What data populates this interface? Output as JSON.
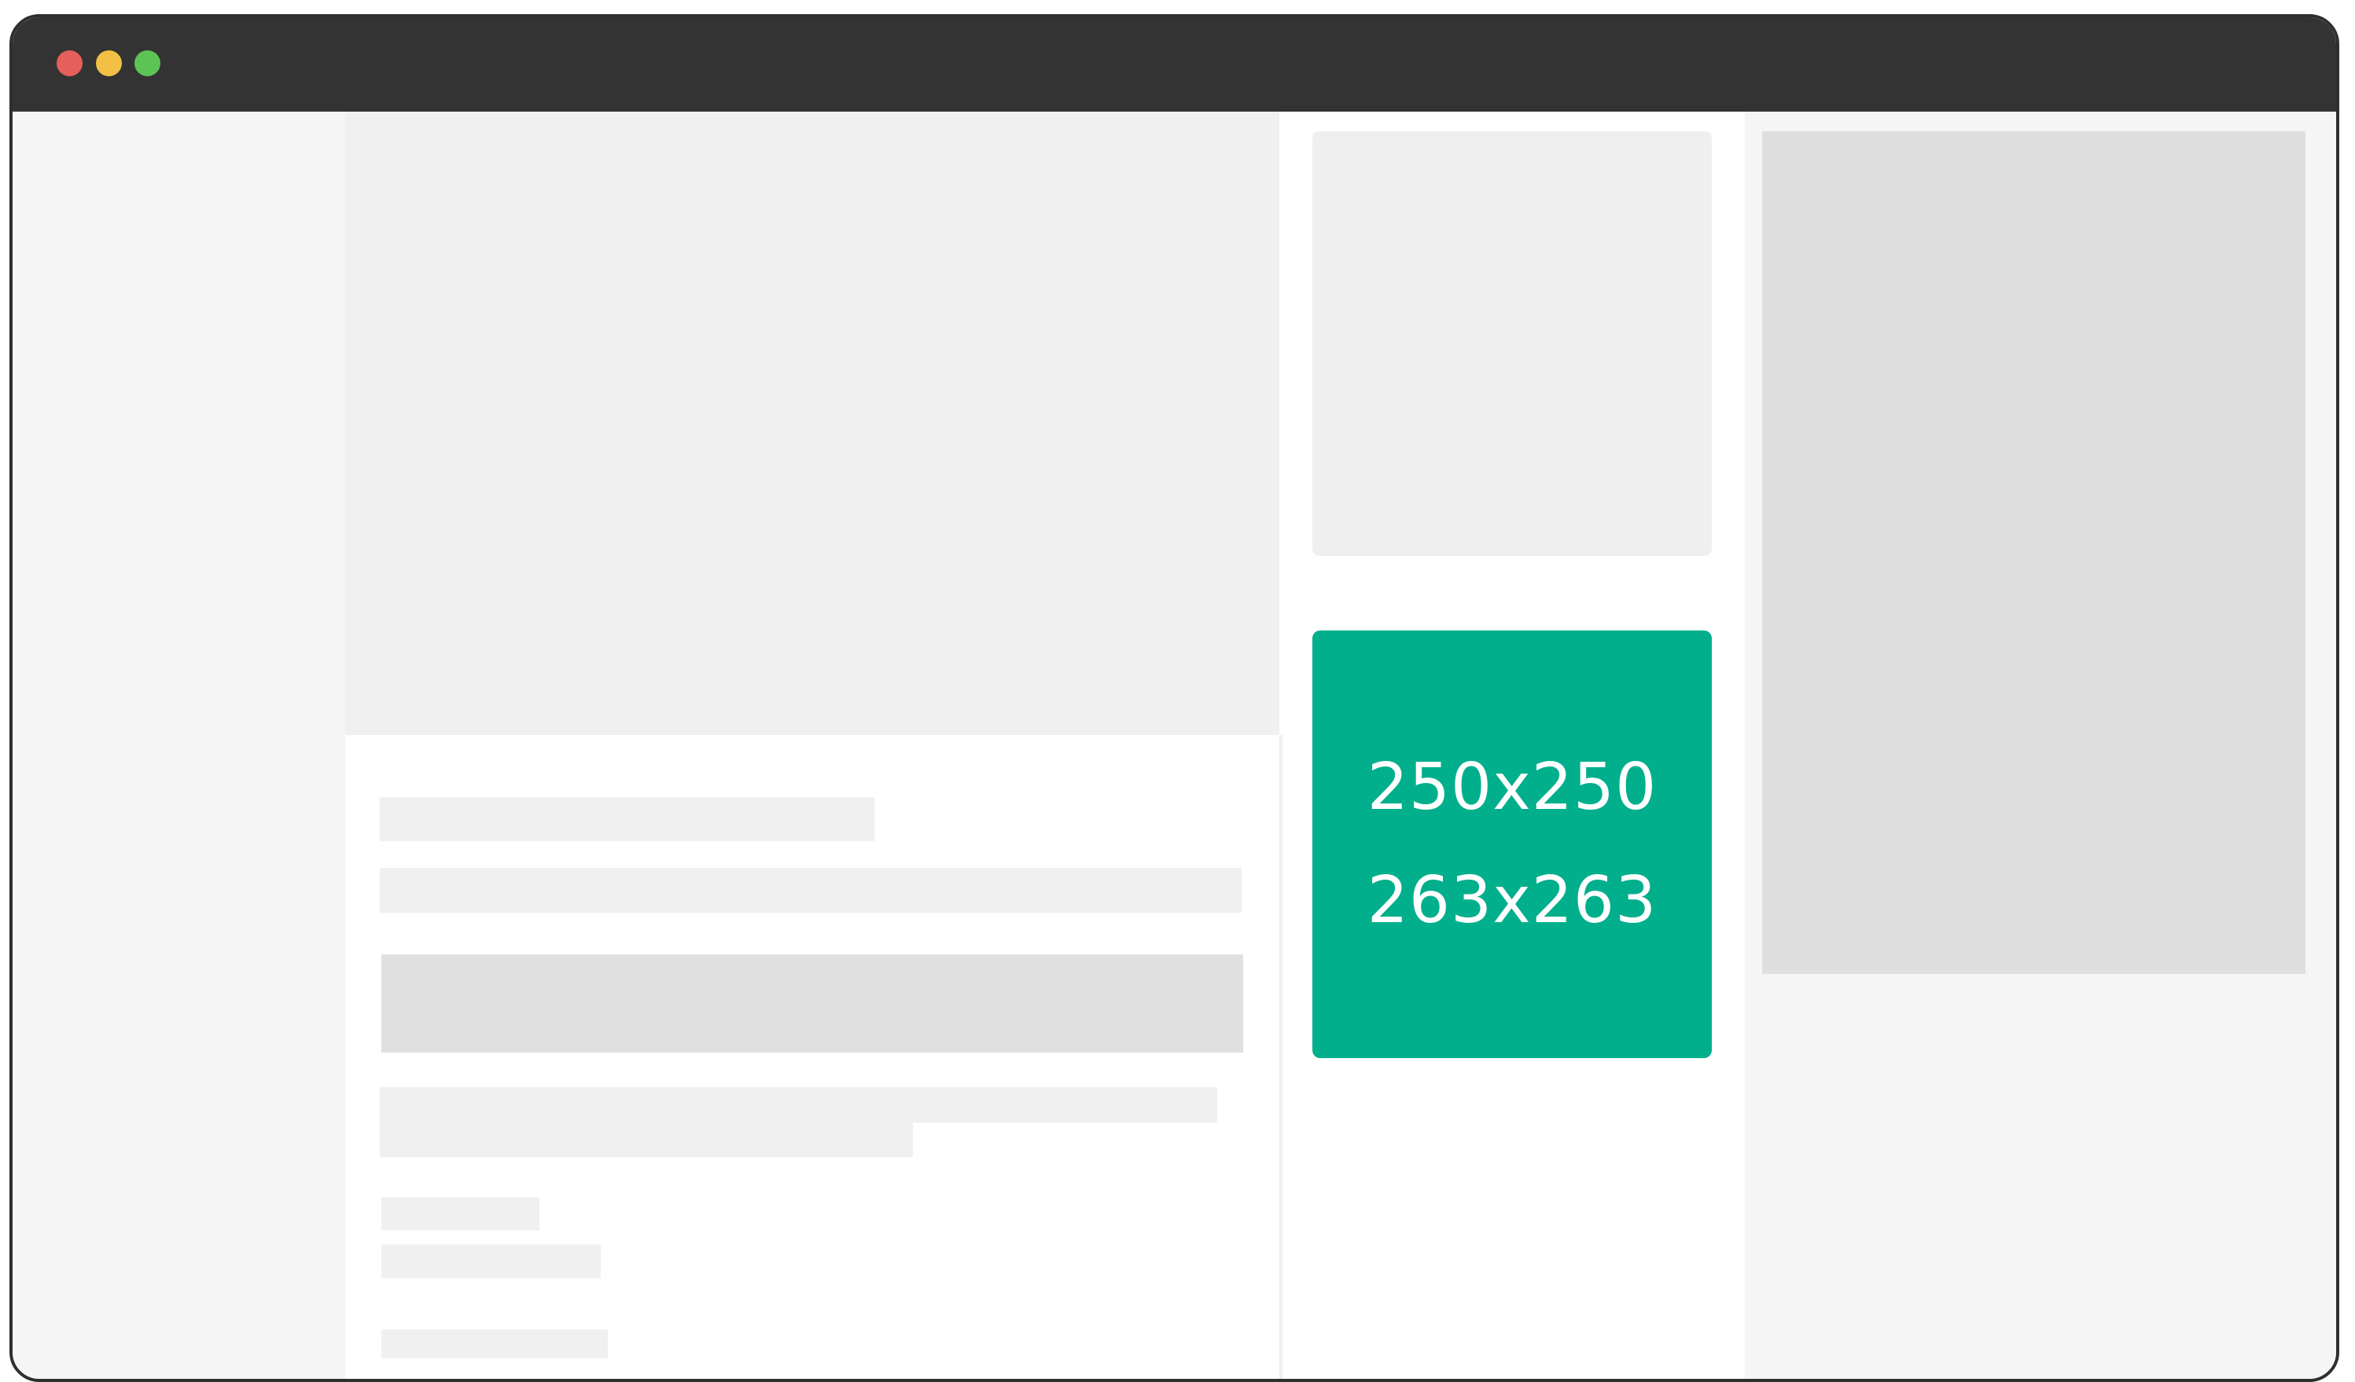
{
  "window": {
    "controls": {
      "close_color": "#e5605a",
      "minimize_color": "#f2c045",
      "maximize_color": "#5cc454"
    },
    "titlebar_color": "#333333"
  },
  "ad": {
    "size_label_1": "250x250",
    "size_label_2": "263x263",
    "background_color": "#02af8c"
  }
}
